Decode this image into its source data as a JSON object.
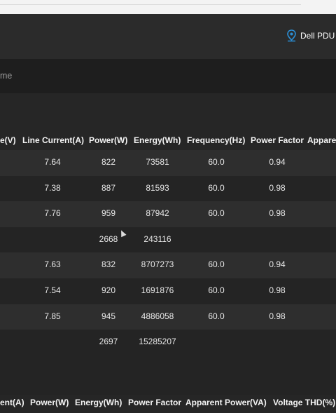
{
  "header": {
    "device_label": "Dell PDU B"
  },
  "breadcrumb": {
    "text": "me"
  },
  "table1": {
    "columns": [
      "e(V)",
      "Line Current(A)",
      "Power(W)",
      "Energy(Wh)",
      "Frequency(Hz)",
      "Power Factor",
      "Appare"
    ],
    "rows": [
      {
        "current": "7.64",
        "power": "822",
        "energy": "73581",
        "freq": "60.0",
        "pf": "0.94"
      },
      {
        "current": "7.38",
        "power": "887",
        "energy": "81593",
        "freq": "60.0",
        "pf": "0.98"
      },
      {
        "current": "7.76",
        "power": "959",
        "energy": "87942",
        "freq": "60.0",
        "pf": "0.98"
      },
      {
        "current": "",
        "power": "2668",
        "energy": "243116",
        "freq": "",
        "pf": ""
      },
      {
        "current": "7.63",
        "power": "832",
        "energy": "8707273",
        "freq": "60.0",
        "pf": "0.94"
      },
      {
        "current": "7.54",
        "power": "920",
        "energy": "1691876",
        "freq": "60.0",
        "pf": "0.98"
      },
      {
        "current": "7.85",
        "power": "945",
        "energy": "4886058",
        "freq": "60.0",
        "pf": "0.98"
      },
      {
        "current": "",
        "power": "2697",
        "energy": "15285207",
        "freq": "",
        "pf": ""
      }
    ]
  },
  "table2": {
    "columns": [
      "ent(A)",
      "Power(W)",
      "Energy(Wh)",
      "Power Factor",
      "Apparent Power(VA)",
      "Voltage THD(%)"
    ]
  },
  "colors": {
    "background": "#242424",
    "row_alt": "#2e2e2e",
    "pin": "#2b8fd6"
  },
  "icons": {
    "location": "location-pin-icon"
  }
}
